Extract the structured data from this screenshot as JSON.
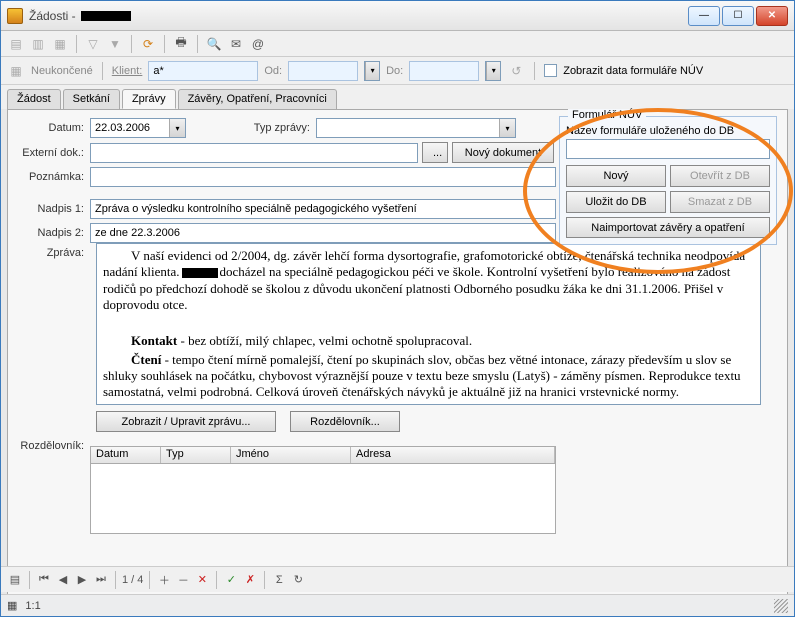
{
  "title": "Žádosti -",
  "filter": {
    "neukoncene": "Neukončené",
    "klient": "Klient:",
    "klient_value": "a*",
    "od": "Od:",
    "do": "Do:",
    "zobrazit_nuv": "Zobrazit data formuláře NÚV"
  },
  "tabs": {
    "zadost": "Žádost",
    "setkani": "Setkání",
    "zpravy": "Zprávy",
    "zavery": "Závěry, Opatření, Pracovníci"
  },
  "form": {
    "datum_lbl": "Datum:",
    "datum_val": "22.03.2006",
    "typ_lbl": "Typ zprávy:",
    "externi_lbl": "Externí dok.:",
    "browse": "...",
    "novy_dokument": "Nový dokument",
    "poznamka_lbl": "Poznámka:",
    "nadpis1_lbl": "Nadpis 1:",
    "nadpis1_val": "Zpráva o výsledku kontrolního speciálně pedagogického vyšetření",
    "nadpis2_lbl": "Nadpis 2:",
    "nadpis2_val": "ze dne 22.3.2006",
    "zprava_lbl": "Zpráva:",
    "zprava_p1a": "V naší evidenci od 2/2004, dg. závěr lehčí forma dysortografie, grafomotorické obtíže, čtenářská technika neodpovídá nadání klienta.",
    "zprava_p1b": "docházel na speciálně pedagogickou péči ve škole.  Kontrolní vyšetření bylo realizováno na žádost rodičů po předchozí dohodě se školou z důvodu ukončení platnosti Odborného posudku žáka ke dni 31.1.2006. Přišel v doprovodu otce.",
    "zprava_p2": "Kontakt - bez obtíží, milý chlapec, velmi ochotně spolupracoval.",
    "zprava_p2b": "Kontakt",
    "zprava_p3a": "Čtení",
    "zprava_p3b": " - tempo čtení mírně pomalejší, čtení po skupinách slov, občas bez větné intonace, zárazy především u slov se shluky souhlásek na počátku, chybovost výraznější pouze v textu beze smyslu (Latyš) - záměny písmen. Reprodukce textu samostatná, velmi podrobná. Celková úroveň čtenářských návyků je aktuálně již na hranici vrstevnické normy.",
    "zobrazit_upravit": "Zobrazit / Upravit zprávu...",
    "rozdelovnik_btn": "Rozdělovník...",
    "rozdelovnik_lbl": "Rozdělovník:"
  },
  "grid": {
    "datum": "Datum",
    "typ": "Typ",
    "jmeno": "Jméno",
    "adresa": "Adresa"
  },
  "nuv": {
    "title": "Formulář NÚV",
    "nazev": "Název formuláře uloženého do DB",
    "novy": "Nový",
    "otevrit": "Otevřít z DB",
    "ulozit": "Uložit do DB",
    "smazat": "Smazat z DB",
    "import": "Naimportovat závěry a opatření"
  },
  "nav": {
    "pos": "1",
    "sep": "/",
    "total": "4"
  },
  "status": {
    "ratio": "1:1"
  }
}
